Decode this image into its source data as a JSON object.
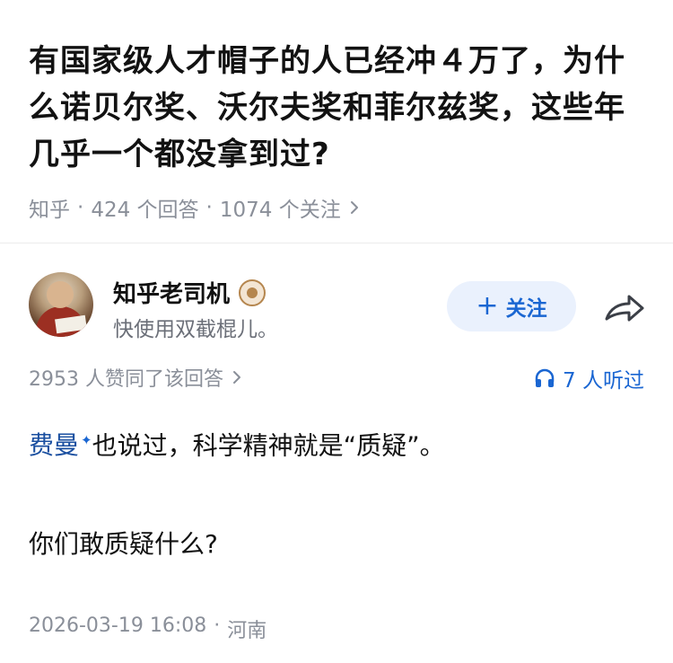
{
  "question": {
    "title": "有国家级人才帽子的人已经冲４万了，为什么诺贝尔奖、沃尔夫奖和菲尔兹奖，这些年几乎一个都没拿到过?",
    "source": "知乎",
    "answers": "424 个回答",
    "followers": "1074 个关注"
  },
  "author": {
    "name": "知乎老司机",
    "description": "快使用双截棍儿。",
    "follow_label": "关注"
  },
  "stats": {
    "likes": "2953 人赞同了该回答",
    "listeners": "7 人听过"
  },
  "answer": {
    "link_text": "费曼",
    "line1_rest": "也说过，科学精神就是“质疑”。",
    "line2": "你们敢质疑什么?"
  },
  "footer": {
    "date": "2026-03-19 16:08",
    "location": "河南"
  },
  "colors": {
    "accent": "#1a66d2",
    "follow_bg": "#eaf1fd",
    "muted": "#8a8f99"
  },
  "icons": [
    "chevron-right-icon",
    "badge-icon",
    "plus-icon",
    "share-icon",
    "headphones-icon"
  ]
}
